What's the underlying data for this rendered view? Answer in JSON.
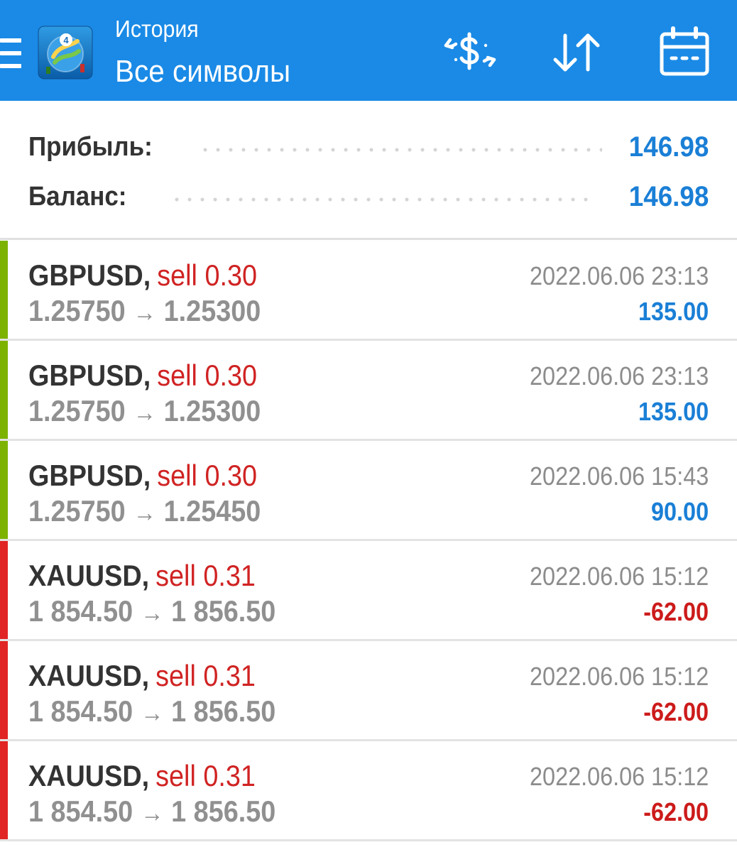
{
  "header": {
    "subtitle": "История",
    "title": "Все символы",
    "icons": [
      "menu-icon",
      "metatrader-logo-icon",
      "currency-exchange-icon",
      "sort-icon",
      "calendar-icon"
    ]
  },
  "summary": {
    "profit_label": "Прибыль:",
    "profit_value": "146.98",
    "balance_label": "Баланс:",
    "balance_value": "146.98"
  },
  "trades": [
    {
      "symbol": "GBPUSD",
      "action": "sell 0.30",
      "open_price": "1.25750",
      "close_price": "1.25300",
      "date": "2022.06.06 23:13",
      "profit": "135.00",
      "result": "profit"
    },
    {
      "symbol": "GBPUSD",
      "action": "sell 0.30",
      "open_price": "1.25750",
      "close_price": "1.25300",
      "date": "2022.06.06 23:13",
      "profit": "135.00",
      "result": "profit"
    },
    {
      "symbol": "GBPUSD",
      "action": "sell 0.30",
      "open_price": "1.25750",
      "close_price": "1.25450",
      "date": "2022.06.06 15:43",
      "profit": "90.00",
      "result": "profit"
    },
    {
      "symbol": "XAUUSD",
      "action": "sell 0.31",
      "open_price": "1 854.50",
      "close_price": "1 856.50",
      "date": "2022.06.06 15:12",
      "profit": "-62.00",
      "result": "loss"
    },
    {
      "symbol": "XAUUSD",
      "action": "sell 0.31",
      "open_price": "1 854.50",
      "close_price": "1 856.50",
      "date": "2022.06.06 15:12",
      "profit": "-62.00",
      "result": "loss"
    },
    {
      "symbol": "XAUUSD",
      "action": "sell 0.31",
      "open_price": "1 854.50",
      "close_price": "1 856.50",
      "date": "2022.06.06 15:12",
      "profit": "-62.00",
      "result": "loss"
    }
  ],
  "arrow_glyph": "→",
  "comma": ",",
  "colors": {
    "toolbar": "#1a8ae6",
    "profit_text": "#1a7fd6",
    "loss_text": "#cc1b1b",
    "sell_text": "#d02323",
    "profit_stripe": "#7db200",
    "loss_stripe": "#e12424"
  }
}
